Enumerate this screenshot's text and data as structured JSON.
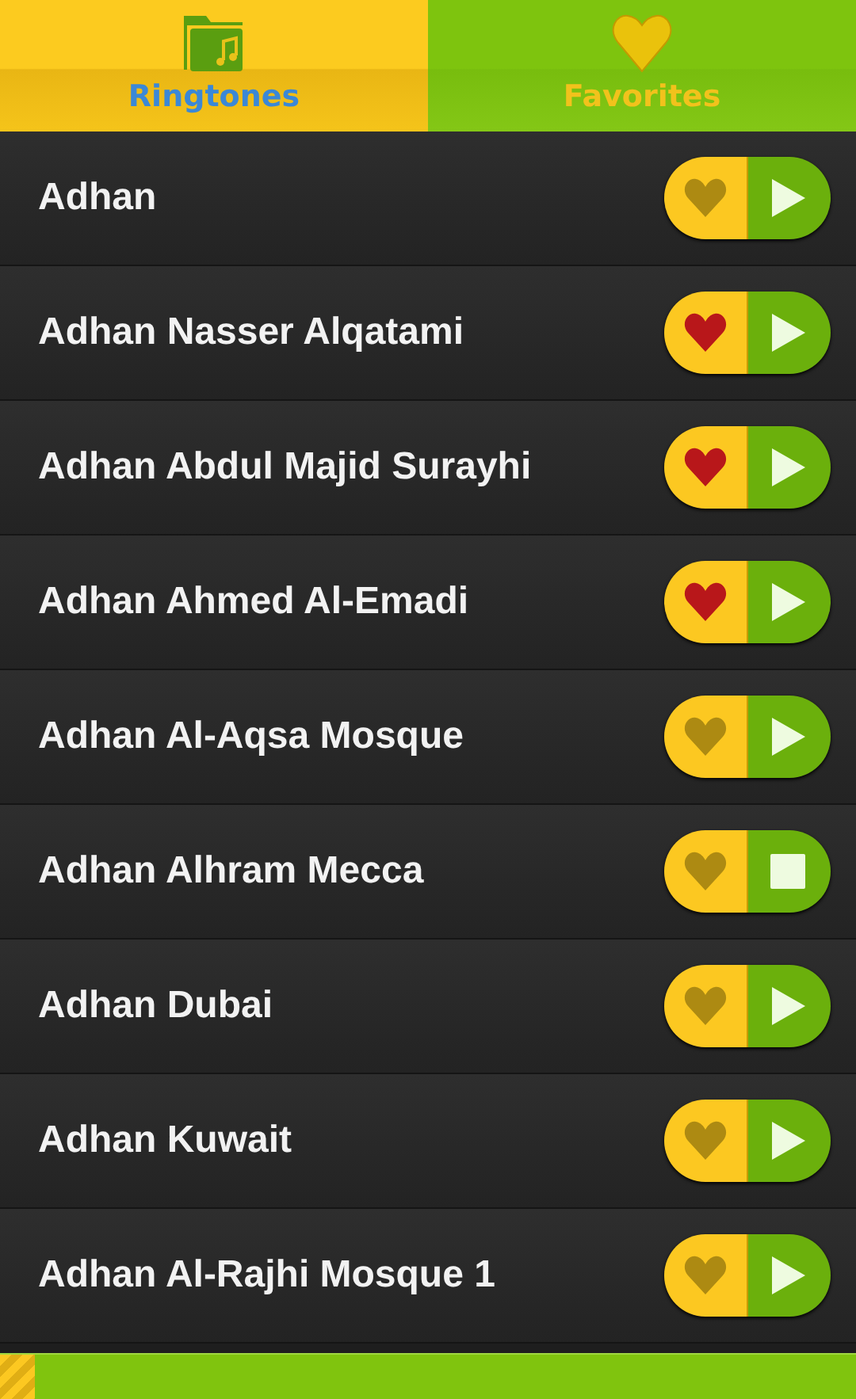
{
  "tabs": [
    {
      "label": "Ringtones",
      "kind": "folder",
      "selected": true
    },
    {
      "label": "Favorites",
      "kind": "heart",
      "selected": false
    }
  ],
  "ringtones": [
    {
      "title": "Adhan",
      "favorite": false,
      "playing": false
    },
    {
      "title": "Adhan Nasser Alqatami",
      "favorite": true,
      "playing": false
    },
    {
      "title": "Adhan Abdul Majid Surayhi",
      "favorite": true,
      "playing": false
    },
    {
      "title": "Adhan Ahmed Al-Emadi",
      "favorite": true,
      "playing": false
    },
    {
      "title": "Adhan Al-Aqsa Mosque",
      "favorite": false,
      "playing": false
    },
    {
      "title": "Adhan Alhram Mecca",
      "favorite": false,
      "playing": true
    },
    {
      "title": "Adhan Dubai",
      "favorite": false,
      "playing": false
    },
    {
      "title": "Adhan Kuwait",
      "favorite": false,
      "playing": false
    },
    {
      "title": "Adhan Al-Rajhi Mosque 1",
      "favorite": false,
      "playing": false
    }
  ],
  "playback_progress": {
    "level": 0.04
  }
}
